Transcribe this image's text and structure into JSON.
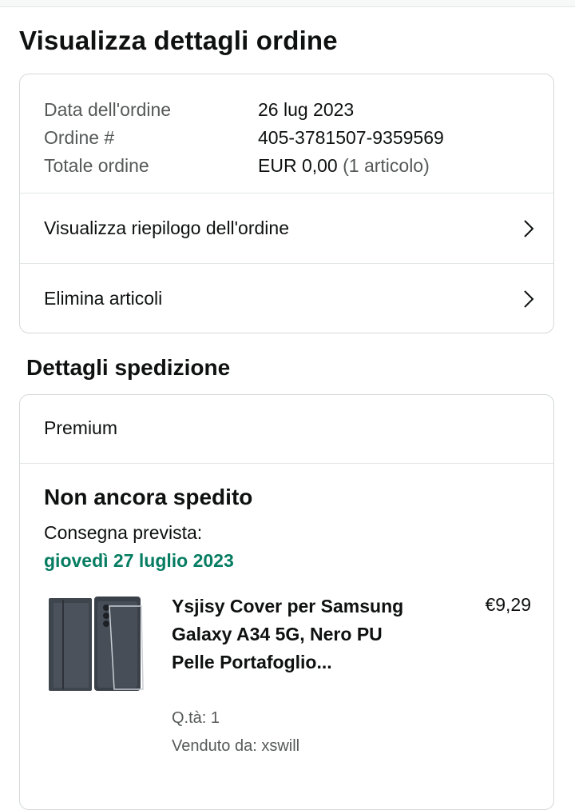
{
  "page": {
    "title": "Visualizza dettagli ordine"
  },
  "order_info": {
    "date_label": "Data dell'ordine",
    "date_value": "26 lug 2023",
    "number_label": "Ordine #",
    "number_value": "405-3781507-9359569",
    "total_label": "Totale ordine",
    "total_value": "EUR 0,00",
    "total_items": "(1 articolo)"
  },
  "actions": {
    "summary_label": "Visualizza riepilogo dell'ordine",
    "remove_label": "Elimina articoli"
  },
  "shipment": {
    "section_title": "Dettagli spedizione",
    "shipping_method": "Premium",
    "status": "Non ancora spedito",
    "delivery_label": "Consegna prevista:",
    "delivery_date": "giovedì 27 luglio 2023",
    "product": {
      "title": "Ysjisy Cover per Samsung Galaxy A34 5G, Nero PU Pelle Portafoglio...",
      "price": "€9,29",
      "quantity": "Q.tà: 1",
      "seller": "Venduto da: xswill"
    }
  },
  "colors": {
    "delivery_green": "#067d62",
    "border": "#d5d9d9",
    "muted_text": "#565959"
  }
}
